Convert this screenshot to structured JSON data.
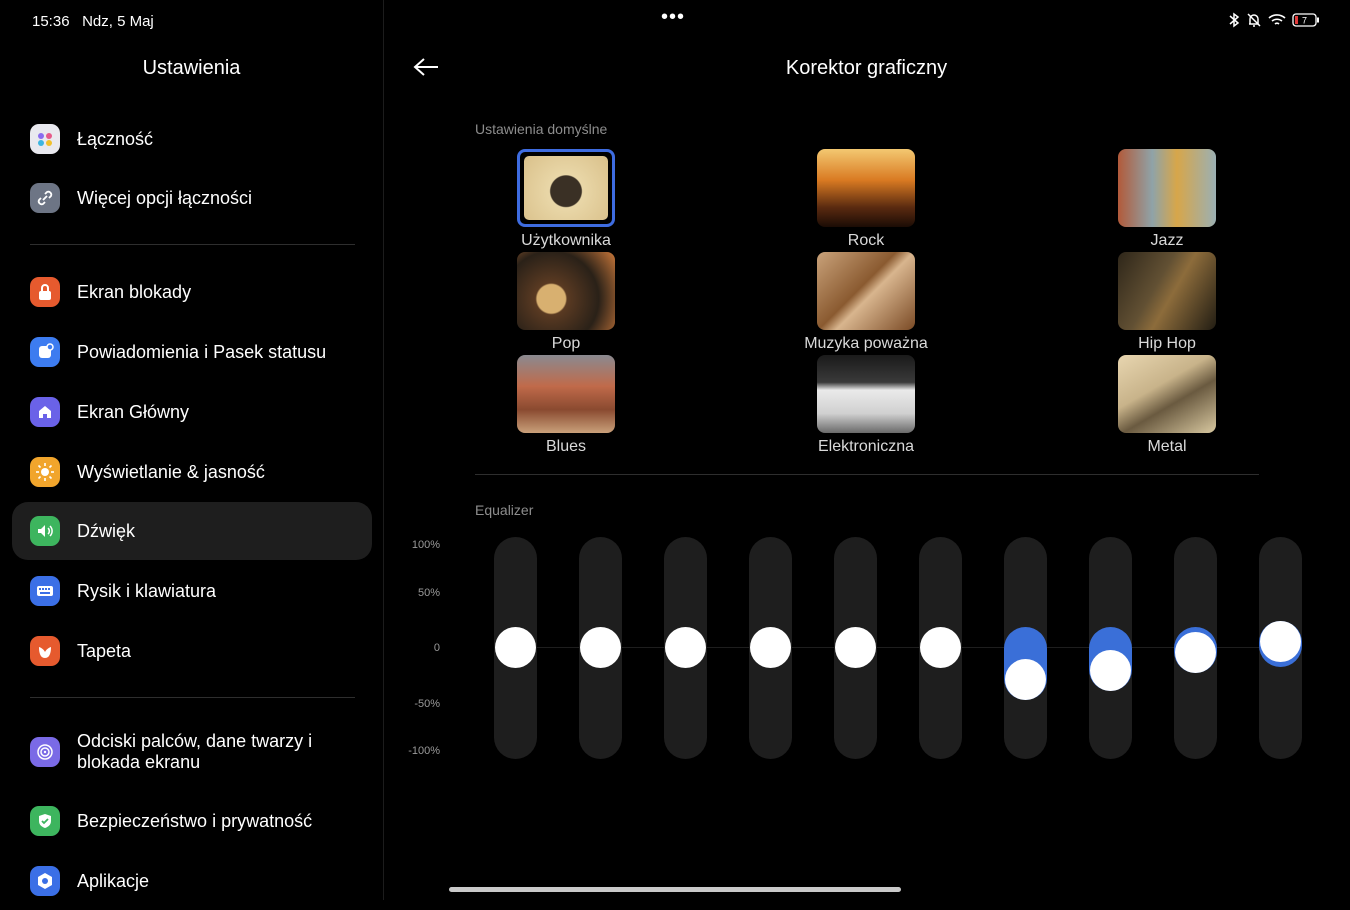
{
  "status": {
    "time": "15:36",
    "date": "Ndz, 5 Maj",
    "battery": "7"
  },
  "sidebar": {
    "title": "Ustawienia",
    "items": [
      {
        "label": "Łączność",
        "icon": "connectivity-icon",
        "color": "#e9e9ef"
      },
      {
        "label": "Więcej opcji łączności",
        "icon": "link-icon",
        "color": "#6d7585"
      },
      {
        "label": "Ekran blokady",
        "icon": "lock-icon",
        "color": "#e65a2e"
      },
      {
        "label": "Powiadomienia i Pasek statusu",
        "icon": "notification-icon",
        "color": "#3d7cf0"
      },
      {
        "label": "Ekran Główny",
        "icon": "home-icon",
        "color": "#6a62e8"
      },
      {
        "label": "Wyświetlanie & jasność",
        "icon": "sun-icon",
        "color": "#f1a52c"
      },
      {
        "label": "Dźwięk",
        "icon": "speaker-icon",
        "color": "#3db55e",
        "active": true
      },
      {
        "label": "Rysik i klawiatura",
        "icon": "keyboard-icon",
        "color": "#3b6fe6"
      },
      {
        "label": "Tapeta",
        "icon": "wallpaper-icon",
        "color": "#e65a2e"
      },
      {
        "label": "Odciski palców, dane twarzy i blokada ekranu",
        "icon": "fingerprint-icon",
        "color": "#7a6ae6"
      },
      {
        "label": "Bezpieczeństwo i prywatność",
        "icon": "shield-icon",
        "color": "#3db55e"
      },
      {
        "label": "Aplikacje",
        "icon": "apps-icon",
        "color": "#3b6fe6"
      }
    ]
  },
  "main": {
    "title": "Korektor graficzny",
    "presets_label": "Ustawienia domyślne",
    "presets": [
      {
        "label": "Użytkownika",
        "selected": true
      },
      {
        "label": "Rock"
      },
      {
        "label": "Jazz"
      },
      {
        "label": "Pop"
      },
      {
        "label": "Muzyka poważna"
      },
      {
        "label": "Hip Hop"
      },
      {
        "label": "Blues"
      },
      {
        "label": "Elektroniczna"
      },
      {
        "label": "Metal"
      }
    ],
    "equalizer_label": "Equalizer",
    "y_ticks": [
      "100%",
      "50%",
      "0",
      "-50%",
      "-100%"
    ]
  },
  "chart_data": {
    "type": "bar",
    "title": "Equalizer",
    "ylim": [
      -100,
      100
    ],
    "y_ticks": [
      "100%",
      "50%",
      "0",
      "-50%",
      "-100%"
    ],
    "series": [
      {
        "values": [
          0,
          0,
          0,
          0,
          0,
          0,
          -32,
          -23,
          -5,
          5
        ]
      }
    ]
  },
  "colors": {
    "accent": "#3a6fd8",
    "track": "#1e1e1e",
    "background": "#000000"
  }
}
